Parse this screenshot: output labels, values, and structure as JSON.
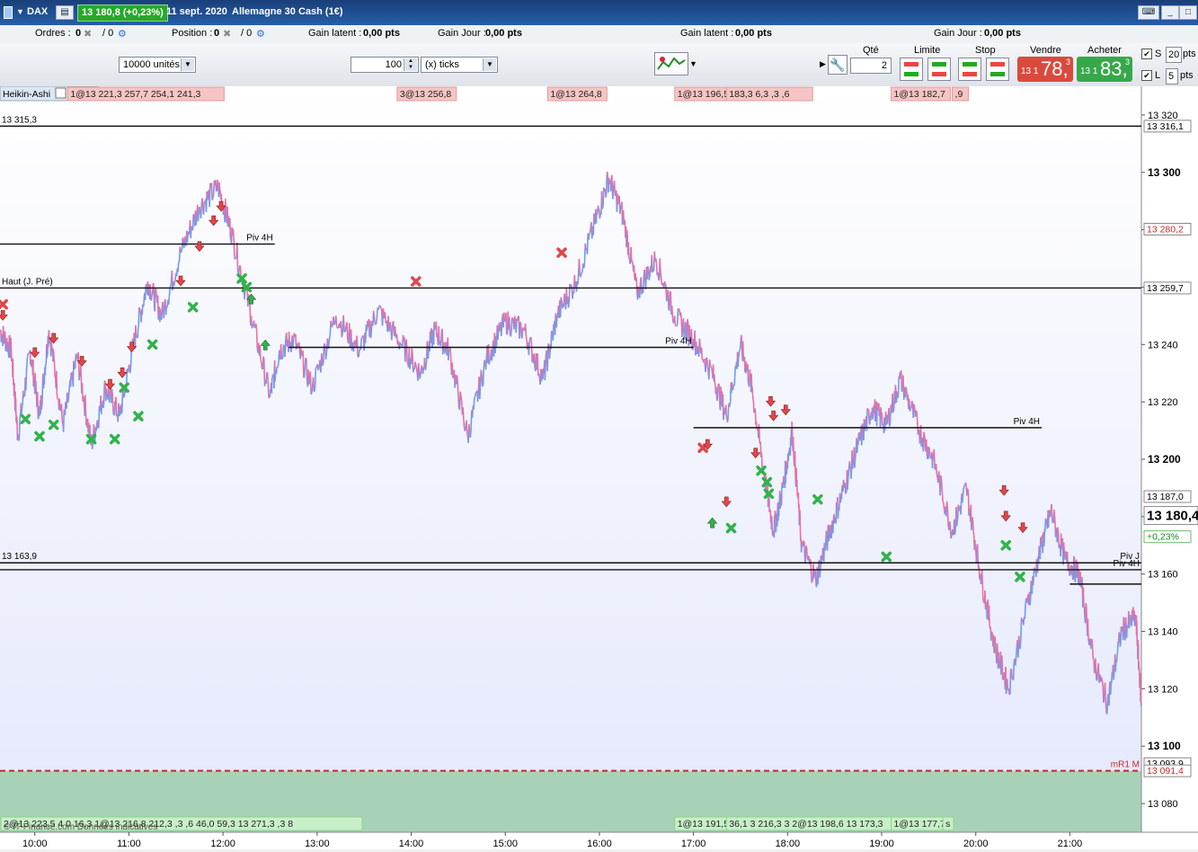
{
  "window": {
    "instrument": "DAX",
    "price_badge": "13 180,8 (+0,23%)",
    "date_label": "11 sept. 2020",
    "contract": "Allemagne 30 Cash (1€)"
  },
  "info_bar": {
    "ordres_label": "Ordres :",
    "ordres_value": "0",
    "ordres_slash": "/ 0",
    "position_label": "Position :",
    "position_value": "0",
    "position_slash": "/ 0",
    "gain_latent_label": "Gain latent :",
    "gain_latent_value": "0,00 pts",
    "gain_jour_label": "Gain Jour :",
    "gain_jour_value": "0,00 pts",
    "gain_latent2_label": "Gain latent :",
    "gain_latent2_value": "0,00 pts",
    "gain_jour2_label": "Gain Jour :",
    "gain_jour2_value": "0,00 pts"
  },
  "toolbar": {
    "units_select": "10000 unités",
    "ticks_input": "100",
    "ticks_select": "(x) ticks",
    "qty_label": "Qté",
    "qty_value": "2",
    "limite_label": "Limite",
    "stop_label": "Stop",
    "sell_label": "Vendre",
    "buy_label": "Acheter",
    "sell_small": "13 1",
    "sell_big": "78,",
    "sell_sup": "3",
    "buy_small": "13 1",
    "buy_big": "83,",
    "buy_sup": "3",
    "s_label": "S",
    "s_value": "20",
    "s_unit": "pts",
    "l_label": "L",
    "l_value": "5",
    "l_unit": "pts"
  },
  "chart_data": {
    "type": "line",
    "chart_style": "Heikin-Ashi",
    "y_range": [
      13070,
      13330
    ],
    "x_range_hours": [
      9.63,
      21.76
    ],
    "y_ticks": [
      13080,
      13100,
      13120,
      13140,
      13160,
      13180,
      13200,
      13220,
      13240,
      13260,
      13280,
      13300,
      13320
    ],
    "y_tick_labels": [
      "13 080",
      "13 100",
      "13 120",
      "13 140",
      "13 160",
      "13 180",
      "13 200",
      "13 220",
      "13 240",
      "13 260",
      "13 280",
      "13 300",
      "13 320"
    ],
    "x_tick_hours": [
      10,
      11,
      12,
      13,
      14,
      15,
      16,
      17,
      18,
      19,
      20,
      21
    ],
    "x_tick_labels": [
      "10:00",
      "11:00",
      "12:00",
      "13:00",
      "14:00",
      "15:00",
      "16:00",
      "17:00",
      "18:00",
      "19:00",
      "20:00",
      "21:00"
    ],
    "price_path": [
      [
        9.63,
        13245
      ],
      [
        9.75,
        13238
      ],
      [
        9.82,
        13208
      ],
      [
        9.95,
        13238
      ],
      [
        10.05,
        13215
      ],
      [
        10.15,
        13245
      ],
      [
        10.3,
        13212
      ],
      [
        10.45,
        13236
      ],
      [
        10.6,
        13205
      ],
      [
        10.75,
        13225
      ],
      [
        10.9,
        13215
      ],
      [
        11.05,
        13240
      ],
      [
        11.2,
        13262
      ],
      [
        11.35,
        13250
      ],
      [
        11.55,
        13272
      ],
      [
        11.75,
        13288
      ],
      [
        11.95,
        13295
      ],
      [
        12.1,
        13278
      ],
      [
        12.3,
        13250
      ],
      [
        12.5,
        13222
      ],
      [
        12.6,
        13238
      ],
      [
        12.75,
        13242
      ],
      [
        12.95,
        13225
      ],
      [
        13.2,
        13250
      ],
      [
        13.45,
        13238
      ],
      [
        13.65,
        13252
      ],
      [
        13.9,
        13240
      ],
      [
        14.1,
        13230
      ],
      [
        14.25,
        13245
      ],
      [
        14.4,
        13238
      ],
      [
        14.6,
        13208
      ],
      [
        14.8,
        13235
      ],
      [
        15.0,
        13248
      ],
      [
        15.2,
        13245
      ],
      [
        15.4,
        13228
      ],
      [
        15.55,
        13250
      ],
      [
        15.75,
        13262
      ],
      [
        15.95,
        13282
      ],
      [
        16.1,
        13298
      ],
      [
        16.25,
        13285
      ],
      [
        16.4,
        13258
      ],
      [
        16.6,
        13270
      ],
      [
        16.8,
        13250
      ],
      [
        17.0,
        13242
      ],
      [
        17.2,
        13230
      ],
      [
        17.35,
        13215
      ],
      [
        17.5,
        13240
      ],
      [
        17.62,
        13225
      ],
      [
        17.75,
        13195
      ],
      [
        17.85,
        13175
      ],
      [
        17.95,
        13190
      ],
      [
        18.05,
        13210
      ],
      [
        18.15,
        13170
      ],
      [
        18.3,
        13158
      ],
      [
        18.45,
        13175
      ],
      [
        18.6,
        13190
      ],
      [
        18.75,
        13205
      ],
      [
        18.9,
        13218
      ],
      [
        19.05,
        13212
      ],
      [
        19.2,
        13228
      ],
      [
        19.4,
        13210
      ],
      [
        19.55,
        13200
      ],
      [
        19.75,
        13175
      ],
      [
        19.9,
        13190
      ],
      [
        20.05,
        13160
      ],
      [
        20.2,
        13135
      ],
      [
        20.35,
        13120
      ],
      [
        20.55,
        13150
      ],
      [
        20.7,
        13170
      ],
      [
        20.8,
        13182
      ],
      [
        20.95,
        13165
      ],
      [
        21.1,
        13160
      ],
      [
        21.25,
        13130
      ],
      [
        21.4,
        13115
      ],
      [
        21.55,
        13140
      ],
      [
        21.7,
        13145
      ],
      [
        21.76,
        13115
      ]
    ],
    "horizontal_lines": [
      {
        "label": "13 315,3",
        "value": 13316.1,
        "x_from": 9.63,
        "x_to": 21.76,
        "label_pos": "left",
        "style": "solid"
      },
      {
        "label": "Piv 4H",
        "value": 13275,
        "x_from": 9.63,
        "x_to": 12.55,
        "label_pos": "right",
        "style": "solid"
      },
      {
        "label": "Haut (J. Pré)",
        "value": 13259.7,
        "x_from": 9.63,
        "x_to": 21.76,
        "label_pos": "left",
        "style": "solid"
      },
      {
        "label": "Piv 4H",
        "value": 13239,
        "x_from": 12.7,
        "x_to": 17.0,
        "label_pos": "right",
        "style": "solid"
      },
      {
        "label": "Piv 4H",
        "value": 13211,
        "x_from": 17.0,
        "x_to": 20.7,
        "label_pos": "right",
        "style": "solid"
      },
      {
        "label": "13 163,9",
        "value": 13163.9,
        "x_from": 9.63,
        "x_to": 21.76,
        "label_pos": "left",
        "style": "solid"
      },
      {
        "label": "Piv J",
        "value": 13163.9,
        "x_from": 9.63,
        "x_to": 21.76,
        "label_pos": "right",
        "style": "solid"
      },
      {
        "label": "Piv 4H",
        "value": 13161.5,
        "x_from": 9.63,
        "x_to": 21.76,
        "label_pos": "right",
        "style": "solid"
      },
      {
        "label": "",
        "value": 13156.5,
        "x_from": 21.0,
        "x_to": 21.76,
        "label_pos": "none",
        "style": "solid"
      },
      {
        "label": "mR1 M",
        "value": 13091.4,
        "x_from": 9.63,
        "x_to": 21.76,
        "label_pos": "right",
        "style": "dashed"
      }
    ],
    "axis_labels": [
      {
        "text": "13 316,1",
        "value": 13316.1,
        "style": "box"
      },
      {
        "text": "13 280,2",
        "value": 13280.2,
        "style": "red"
      },
      {
        "text": "13 259,7",
        "value": 13259.7,
        "style": "box"
      },
      {
        "text": "13 187,0",
        "value": 13187.0,
        "style": "box"
      },
      {
        "text": "13 180,4",
        "value": 13180.4,
        "style": "current"
      },
      {
        "text": "+0,23%",
        "value": 13173.0,
        "style": "green"
      },
      {
        "text": "13 093,9",
        "value": 13093.9,
        "style": "box"
      },
      {
        "text": "13 091,4",
        "value": 13091.4,
        "style": "red"
      }
    ],
    "markers": [
      {
        "t": 9.66,
        "v": 13254,
        "type": "x-red"
      },
      {
        "t": 9.66,
        "v": 13250,
        "type": "arrow-down"
      },
      {
        "t": 9.9,
        "v": 13214,
        "type": "x-green"
      },
      {
        "t": 10.0,
        "v": 13237,
        "type": "arrow-down"
      },
      {
        "t": 10.05,
        "v": 13208,
        "type": "x-green"
      },
      {
        "t": 10.2,
        "v": 13242,
        "type": "arrow-down"
      },
      {
        "t": 10.2,
        "v": 13212,
        "type": "x-green"
      },
      {
        "t": 10.5,
        "v": 13234,
        "type": "arrow-down"
      },
      {
        "t": 10.6,
        "v": 13207,
        "type": "x-green"
      },
      {
        "t": 10.8,
        "v": 13226,
        "type": "arrow-down"
      },
      {
        "t": 10.85,
        "v": 13207,
        "type": "x-green"
      },
      {
        "t": 10.93,
        "v": 13230,
        "type": "arrow-down"
      },
      {
        "t": 10.95,
        "v": 13225,
        "type": "x-green"
      },
      {
        "t": 11.03,
        "v": 13239,
        "type": "arrow-down"
      },
      {
        "t": 11.1,
        "v": 13215,
        "type": "x-green"
      },
      {
        "t": 11.25,
        "v": 13240,
        "type": "x-green"
      },
      {
        "t": 11.55,
        "v": 13262,
        "type": "arrow-down"
      },
      {
        "t": 11.68,
        "v": 13253,
        "type": "x-green"
      },
      {
        "t": 11.75,
        "v": 13274,
        "type": "arrow-down"
      },
      {
        "t": 11.9,
        "v": 13283,
        "type": "arrow-down"
      },
      {
        "t": 11.98,
        "v": 13288,
        "type": "arrow-down"
      },
      {
        "t": 12.2,
        "v": 13263,
        "type": "x-green"
      },
      {
        "t": 12.25,
        "v": 13260,
        "type": "x-green"
      },
      {
        "t": 12.3,
        "v": 13256,
        "type": "arrow-up"
      },
      {
        "t": 12.45,
        "v": 13240,
        "type": "arrow-up"
      },
      {
        "t": 14.05,
        "v": 13262,
        "type": "x-red"
      },
      {
        "t": 15.6,
        "v": 13272,
        "type": "x-red"
      },
      {
        "t": 17.1,
        "v": 13204,
        "type": "x-red"
      },
      {
        "t": 17.15,
        "v": 13205,
        "type": "arrow-down"
      },
      {
        "t": 17.2,
        "v": 13178,
        "type": "arrow-up"
      },
      {
        "t": 17.35,
        "v": 13185,
        "type": "arrow-down"
      },
      {
        "t": 17.4,
        "v": 13176,
        "type": "x-green"
      },
      {
        "t": 17.66,
        "v": 13202,
        "type": "arrow-down"
      },
      {
        "t": 17.72,
        "v": 13196,
        "type": "x-green"
      },
      {
        "t": 17.78,
        "v": 13192,
        "type": "x-green"
      },
      {
        "t": 17.8,
        "v": 13188,
        "type": "x-green"
      },
      {
        "t": 17.82,
        "v": 13220,
        "type": "arrow-down"
      },
      {
        "t": 17.85,
        "v": 13215,
        "type": "arrow-down"
      },
      {
        "t": 17.98,
        "v": 13217,
        "type": "arrow-down"
      },
      {
        "t": 18.32,
        "v": 13186,
        "type": "x-green"
      },
      {
        "t": 19.05,
        "v": 13166,
        "type": "x-green"
      },
      {
        "t": 20.3,
        "v": 13189,
        "type": "arrow-down"
      },
      {
        "t": 20.32,
        "v": 13180,
        "type": "arrow-down"
      },
      {
        "t": 20.32,
        "v": 13170,
        "type": "x-green"
      },
      {
        "t": 20.5,
        "v": 13176,
        "type": "arrow-down"
      },
      {
        "t": 20.47,
        "v": 13159,
        "type": "x-green"
      }
    ],
    "top_labels": [
      {
        "t": 9.63,
        "text": "Heikin-Ashi",
        "style": "plain"
      },
      {
        "t": 10.35,
        "text": "1@13 221,3 257,7 254,1 241,3",
        "style": "red"
      },
      {
        "t": 13.85,
        "text": "3@13 256,8",
        "style": "red"
      },
      {
        "t": 15.45,
        "text": "1@13 264,8",
        "style": "red"
      },
      {
        "t": 16.8,
        "text": "1@13 196,5",
        "style": "red"
      },
      {
        "t": 17.35,
        "text": "183,3 6,3 ,3 ,6",
        "style": "red"
      },
      {
        "t": 19.1,
        "text": "1@13 182,7",
        "style": "red"
      },
      {
        "t": 19.75,
        "text": ",9",
        "style": "red"
      }
    ],
    "bottom_labels": [
      {
        "t": 9.64,
        "text": "2@13 223,5 4 0 16,3 1@13 216,8 212,3 ,3 ,6 46,0 59,3 13 271,3 ,3 8",
        "style": "green"
      },
      {
        "t": 16.8,
        "text": "1@13 191,5",
        "style": "green"
      },
      {
        "t": 17.35,
        "text": "36,1 3 216,3 3 2@13 198,6 13 173,3",
        "style": "green"
      },
      {
        "t": 19.1,
        "text": "1@13 177,7",
        "style": "green"
      },
      {
        "t": 19.65,
        "text": "s",
        "style": "green"
      }
    ],
    "watermark": "© IT-Finance.com Données indicatives"
  },
  "colors": {
    "up": "#6e9cf0",
    "down": "#ef6ea1",
    "green_zone": "#a8d2b8",
    "red_dashed": "#c42a2a",
    "sell_bg": "#d94a3e",
    "buy_bg": "#37a84a"
  }
}
